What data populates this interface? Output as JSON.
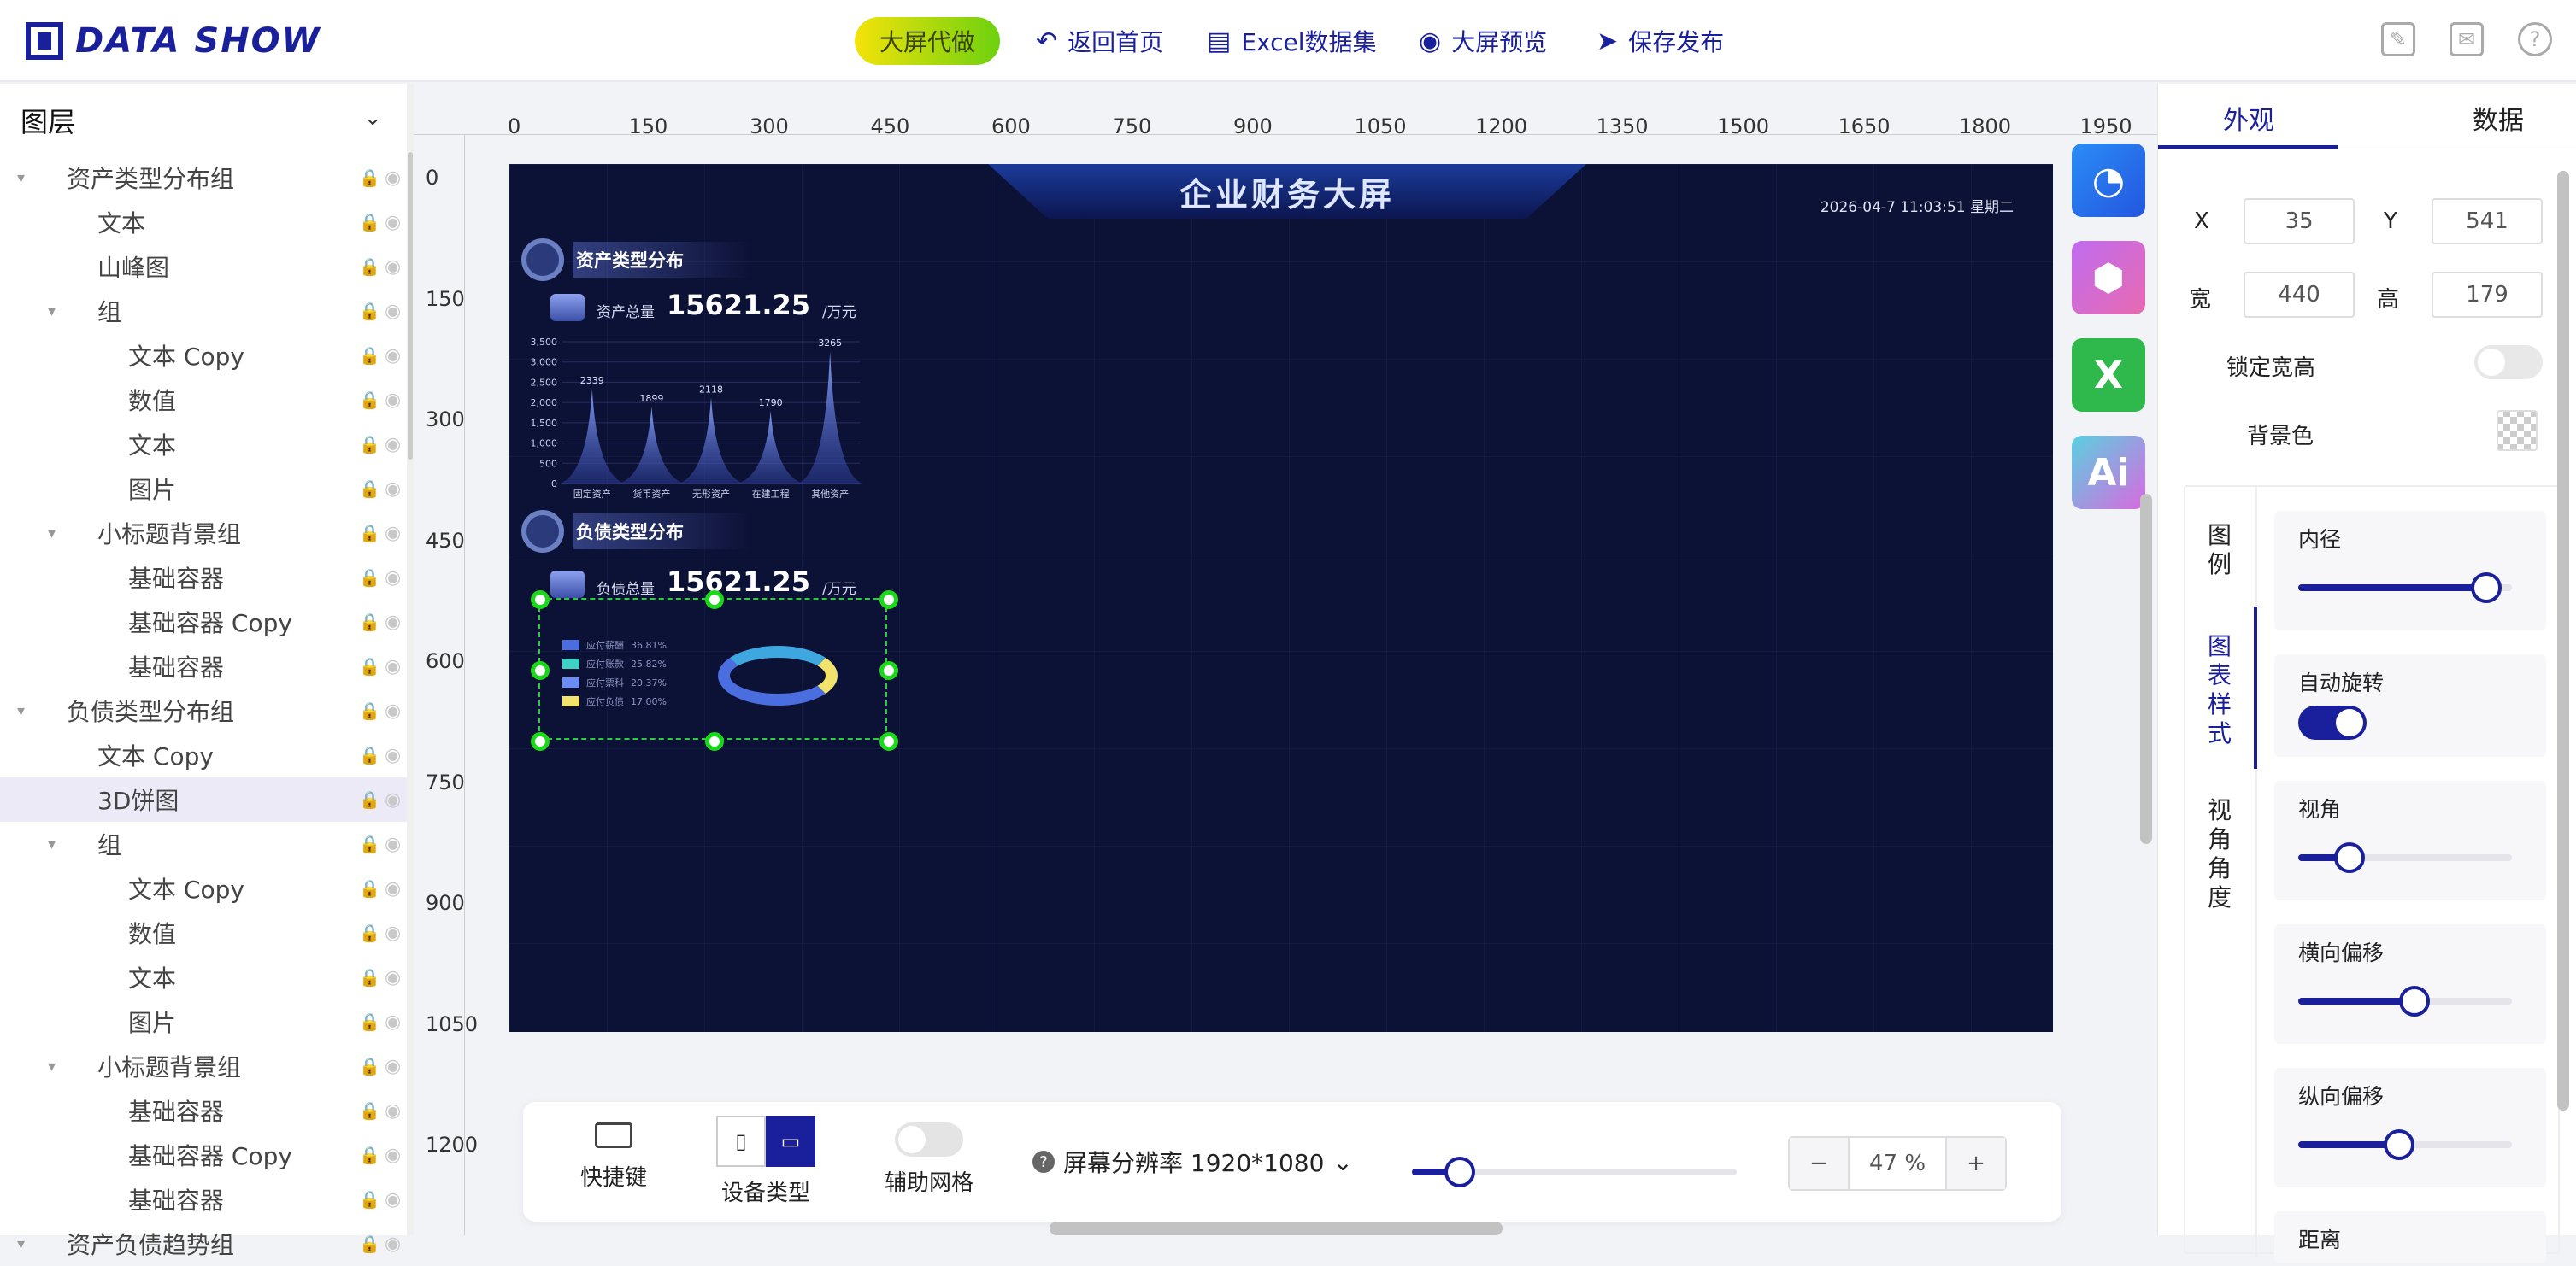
{
  "header": {
    "logo": "DATA SHOW",
    "ai_btn": "大屏代做",
    "nav": [
      {
        "icon": "back-icon",
        "label": "返回首页"
      },
      {
        "icon": "excel-icon",
        "label": "Excel数据集"
      },
      {
        "icon": "eye-icon",
        "label": "大屏预览"
      },
      {
        "icon": "send-icon",
        "label": "保存发布"
      }
    ]
  },
  "layers": {
    "title": "图层",
    "items": [
      {
        "label": "资产类型分布组",
        "indent": 0,
        "caret": true
      },
      {
        "label": "文本",
        "indent": 1,
        "caret": false
      },
      {
        "label": "山峰图",
        "indent": 1,
        "caret": false
      },
      {
        "label": "组",
        "indent": 1,
        "caret": true
      },
      {
        "label": "文本 Copy",
        "indent": 2,
        "caret": false
      },
      {
        "label": "数值",
        "indent": 2,
        "caret": false
      },
      {
        "label": "文本",
        "indent": 2,
        "caret": false
      },
      {
        "label": "图片",
        "indent": 2,
        "caret": false
      },
      {
        "label": "小标题背景组",
        "indent": 1,
        "caret": true
      },
      {
        "label": "基础容器",
        "indent": 2,
        "caret": false
      },
      {
        "label": "基础容器 Copy",
        "indent": 2,
        "caret": false
      },
      {
        "label": "基础容器",
        "indent": 2,
        "caret": false
      },
      {
        "label": "负债类型分布组",
        "indent": 0,
        "caret": true
      },
      {
        "label": "文本 Copy",
        "indent": 1,
        "caret": false
      },
      {
        "label": "3D饼图",
        "indent": 1,
        "caret": false,
        "selected": true
      },
      {
        "label": "组",
        "indent": 1,
        "caret": true
      },
      {
        "label": "文本 Copy",
        "indent": 2,
        "caret": false
      },
      {
        "label": "数值",
        "indent": 2,
        "caret": false
      },
      {
        "label": "文本",
        "indent": 2,
        "caret": false
      },
      {
        "label": "图片",
        "indent": 2,
        "caret": false
      },
      {
        "label": "小标题背景组",
        "indent": 1,
        "caret": true
      },
      {
        "label": "基础容器",
        "indent": 2,
        "caret": false
      },
      {
        "label": "基础容器 Copy",
        "indent": 2,
        "caret": false
      },
      {
        "label": "基础容器",
        "indent": 2,
        "caret": false
      },
      {
        "label": "资产负债趋势组",
        "indent": 0,
        "caret": true
      }
    ]
  },
  "ruler": {
    "h": [
      "0",
      "150",
      "300",
      "450",
      "600",
      "750",
      "900",
      "1050",
      "1200",
      "1350",
      "1500",
      "1650",
      "1800",
      "1950"
    ],
    "v": [
      "0",
      "150",
      "300",
      "450",
      "600",
      "750",
      "900",
      "1050",
      "1200"
    ]
  },
  "screen": {
    "title": "企业财务大屏",
    "datetime": "2026-04-7 11:03:51 星期二",
    "asset_title": "资产类型分布",
    "asset_label": "资产总量",
    "asset_value": "15621.25",
    "asset_unit": "/万元",
    "debt_title": "负债类型分布",
    "debt_label": "负债总量",
    "debt_value": "15621.25",
    "debt_unit": "/万元"
  },
  "chart_data": [
    {
      "type": "area",
      "categories": [
        "固定资产",
        "货币资产",
        "无形资产",
        "在建工程",
        "其他资产"
      ],
      "values": [
        2339,
        1899,
        2118,
        1790,
        3265
      ],
      "ylim": [
        0,
        3500
      ],
      "yticks": [
        "3,500",
        "3,000",
        "2,500",
        "2,000",
        "1,500",
        "1,000",
        "500",
        "0"
      ]
    },
    {
      "type": "pie",
      "series": [
        {
          "name": "应付薪酬",
          "value": "36.81%",
          "color": "#4a6ee0"
        },
        {
          "name": "应付账款",
          "value": "25.82%",
          "color": "#3fd0c8"
        },
        {
          "name": "应付票科",
          "value": "20.37%",
          "color": "#6b8cf5"
        },
        {
          "name": "应付负债",
          "value": "17.00%",
          "color": "#f1e36b"
        }
      ]
    }
  ],
  "bottom": {
    "shortcut": "快捷键",
    "device": "设备类型",
    "grid": "辅助网格",
    "resolution": "屏幕分辨率  1920*1080",
    "zoom": "47 %",
    "zoom_level": 0.47,
    "minus": "−",
    "plus": "+"
  },
  "right": {
    "tab_appearance": "外观",
    "tab_data": "数据",
    "x_label": "X",
    "x": "35",
    "y_label": "Y",
    "y": "541",
    "w_label": "宽",
    "w": "440",
    "h_label": "高",
    "h": "179",
    "lock_ratio": "锁定宽高",
    "bg_color": "背景色",
    "vtabs": [
      "图例",
      "图表样式",
      "视角角度"
    ],
    "inner_radius": "内径",
    "auto_rotate": "自动旋转",
    "view_angle": "视角",
    "h_offset": "横向偏移",
    "v_offset": "纵向偏移",
    "distance": "距离"
  }
}
